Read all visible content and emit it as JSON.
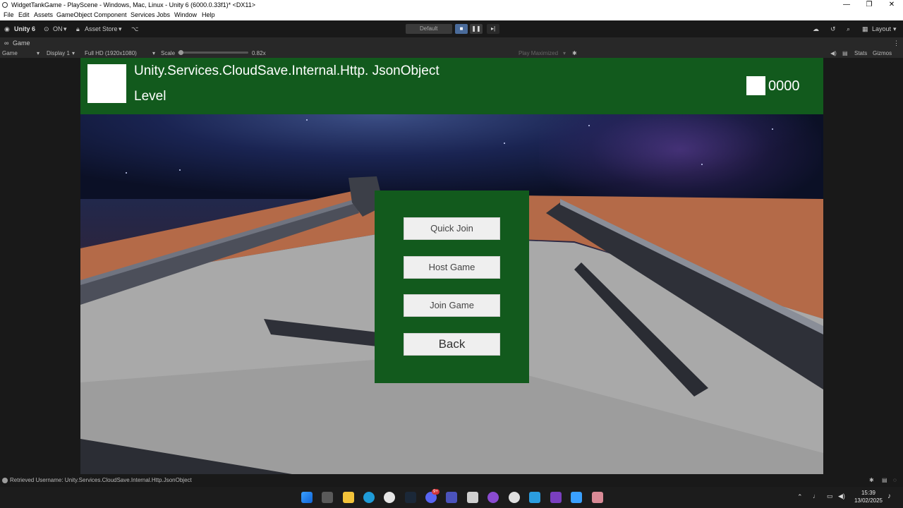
{
  "window": {
    "title": "WidgetTankGame - PlayScene - Windows, Mac, Linux - Unity 6 (6000.0.33f1)* <DX11>",
    "minimize": "—",
    "maximize": "❐",
    "close": "✕"
  },
  "menu": [
    "File",
    "Edit",
    "Assets",
    "GameObject",
    "Component",
    "Services",
    "Jobs",
    "Window",
    "Help"
  ],
  "toolbar": {
    "unity_label": "Unity 6",
    "on_label": "ON",
    "asset_store_label": "Asset Store",
    "default_label": "Default",
    "layout_label": "Layout"
  },
  "game_tab": {
    "label": "Game",
    "dropdown_game": "Game",
    "display": "Display 1",
    "resolution": "Full HD (1920x1080)",
    "scale_label": "Scale",
    "scale_value": "0.82x",
    "play_mode": "Play Maximized",
    "stats": "Stats",
    "gizmos": "Gizmos"
  },
  "hud": {
    "player_name": "Unity.Services.CloudSave.Internal.Http. JsonObject",
    "level_label": "Level",
    "score": "0000"
  },
  "main_menu": {
    "quick_join": "Quick Join",
    "host_game": "Host Game",
    "join_game": "Join Game",
    "back": "Back"
  },
  "status_bar": {
    "message": "Retrieved Username: Unity.Services.CloudSave.Internal.Http.JsonObject"
  },
  "taskbar": {
    "time": "15:39",
    "date": "13/02/2025",
    "notification_badge": "9+"
  },
  "colors": {
    "hud_green": "#125a1d",
    "button_bg": "#efefef",
    "floor_orange": "#b46a48"
  }
}
